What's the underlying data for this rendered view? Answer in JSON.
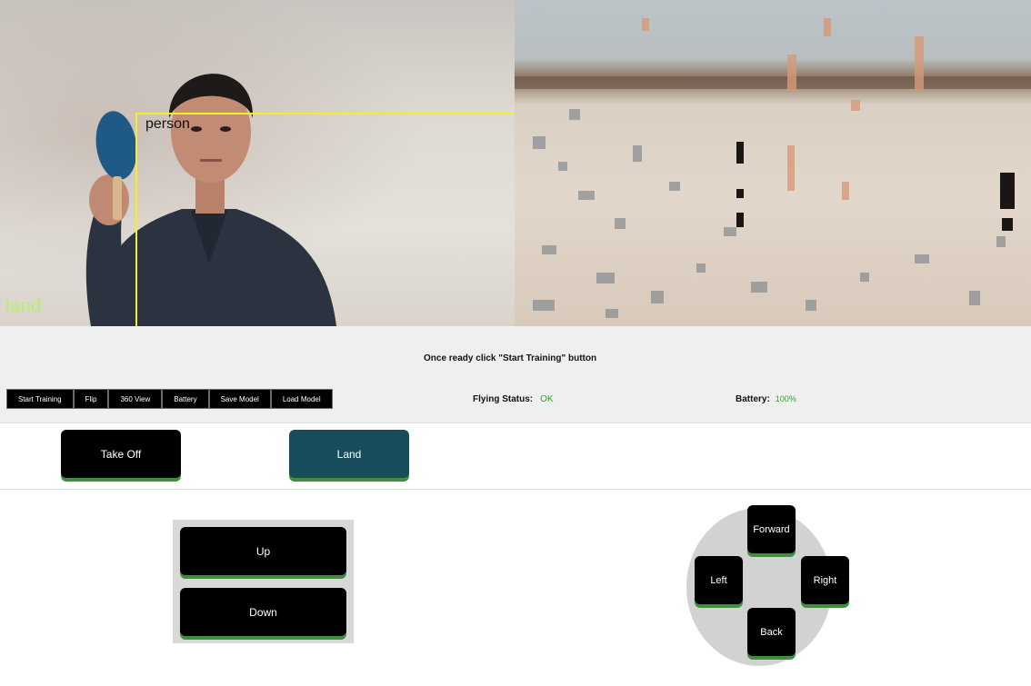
{
  "camera": {
    "detection_label": "person",
    "gesture_label": "land"
  },
  "status": {
    "instruction": "Once ready click \"Start Training\" button",
    "flying_status_label": "Flying Status:",
    "flying_status_value": "OK",
    "battery_label": "Battery:",
    "battery_value": "100%"
  },
  "toolbar": [
    "Start Training",
    "Flip",
    "360 View",
    "Battery",
    "Save Model",
    "Load Model"
  ],
  "actions": {
    "take_off": "Take Off",
    "land": "Land"
  },
  "altitude": {
    "up": "Up",
    "down": "Down"
  },
  "dpad": {
    "forward": "Forward",
    "left": "Left",
    "right": "Right",
    "back": "Back"
  },
  "colors": {
    "detection_box": "#f2ee2e",
    "gesture_text": "#b7f06a",
    "status_ok": "#2aa52a",
    "land_button": "#184d5d",
    "button_shadow": "#3f8f3f"
  }
}
